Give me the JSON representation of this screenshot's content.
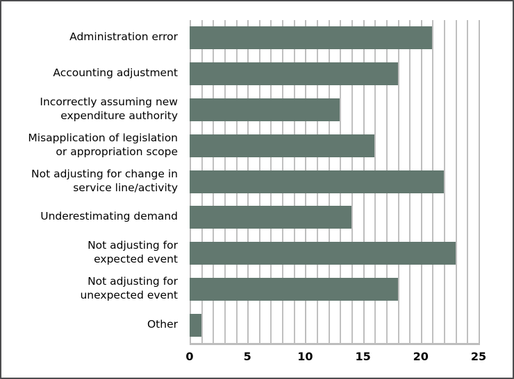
{
  "chart_data": {
    "type": "bar",
    "orientation": "horizontal",
    "title": "",
    "xlabel": "",
    "ylabel": "",
    "xlim": [
      0,
      25
    ],
    "x_ticks": [
      "0",
      "5",
      "10",
      "15",
      "20",
      "25"
    ],
    "x_tick_values": [
      0,
      5,
      10,
      15,
      20,
      25
    ],
    "minor_gridline_step": 1,
    "grid": true,
    "legend": false,
    "bar_color": "#62786f",
    "gridline_color": "#c0c0c0",
    "border_color": "#4d4d4f",
    "categories": [
      "Administration error",
      "Accounting adjustment",
      "Incorrectly assuming new\nexpenditure authority",
      "Misapplication of legislation\nor appropriation scope",
      "Not adjusting for change in\nservice line/activity",
      "Underestimating demand",
      "Not adjusting for\nexpected event",
      "Not adjusting for\nunexpected event",
      "Other"
    ],
    "values": [
      21,
      18,
      13,
      16,
      22,
      14,
      23,
      18,
      1
    ]
  }
}
